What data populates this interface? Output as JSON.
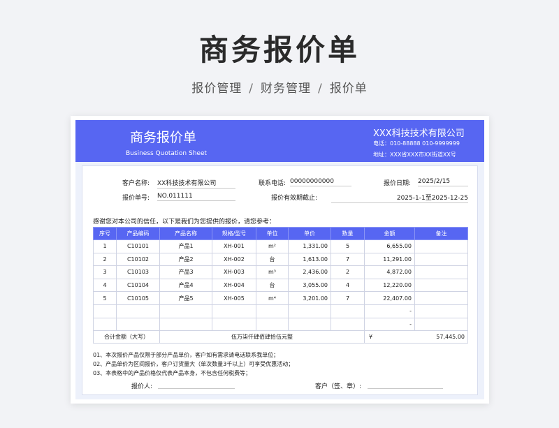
{
  "page": {
    "title": "商务报价单",
    "breadcrumb": [
      "报价管理",
      "财务管理",
      "报价单"
    ]
  },
  "header": {
    "doc_title": "商务报价单",
    "doc_subtitle": "Business Quotation Sheet",
    "company": "XXX科技技术有限公司",
    "contact": "电话：010-88888    010-9999999",
    "address": "地址：XXX省XXX市XX街道XX号"
  },
  "info": {
    "customer_label": "客户名称:",
    "customer_value": "XX科技技术有限公司",
    "phone_label": "联系电话:",
    "phone_value": "00000000000",
    "date_label": "报价日期:",
    "date_value": "2025/2/15",
    "number_label": "报价单号:",
    "number_value": "NO.011111",
    "valid_label": "报价有效期截止:",
    "valid_value": "2025-1-1至2025-12-25"
  },
  "intro": "感谢您对本公司的信任，以下是我们为您提供的报价，请您参考：",
  "table": {
    "headers": [
      "序号",
      "产品编码",
      "产品名称",
      "规格/型号",
      "单位",
      "单价",
      "数量",
      "金额",
      "备注"
    ],
    "rows": [
      {
        "no": "1",
        "code": "C10101",
        "name": "产品1",
        "spec": "XH-001",
        "unit": "m²",
        "price": "1,331.00",
        "qty": "5",
        "amount": "6,655.00",
        "remark": ""
      },
      {
        "no": "2",
        "code": "C10102",
        "name": "产品2",
        "spec": "XH-002",
        "unit": "台",
        "price": "1,613.00",
        "qty": "7",
        "amount": "11,291.00",
        "remark": ""
      },
      {
        "no": "3",
        "code": "C10103",
        "name": "产品3",
        "spec": "XH-003",
        "unit": "m³",
        "price": "2,436.00",
        "qty": "2",
        "amount": "4,872.00",
        "remark": ""
      },
      {
        "no": "4",
        "code": "C10104",
        "name": "产品4",
        "spec": "XH-004",
        "unit": "台",
        "price": "3,055.00",
        "qty": "4",
        "amount": "12,220.00",
        "remark": ""
      },
      {
        "no": "5",
        "code": "C10105",
        "name": "产品5",
        "spec": "XH-005",
        "unit": "m⁴",
        "price": "3,201.00",
        "qty": "7",
        "amount": "22,407.00",
        "remark": ""
      },
      {
        "no": "",
        "code": "",
        "name": "",
        "spec": "",
        "unit": "",
        "price": "",
        "qty": "",
        "amount": "-",
        "remark": ""
      },
      {
        "no": "",
        "code": "",
        "name": "",
        "spec": "",
        "unit": "",
        "price": "",
        "qty": "",
        "amount": "-",
        "remark": ""
      }
    ],
    "total_label": "合计金额（大写）",
    "total_words": "伍万柒仟肆佰肆拾伍元整",
    "currency": "¥",
    "total_value": "57,445.00"
  },
  "notes": [
    "01、本次报价产品仅限于部分产品单价，客户如有需求请电话联系我单位；",
    "02、产品单价为区间报价，客户订货量大（单次数量3千以上）可享受优惠活动；",
    "03、本表格中的产品价格仅代表产品本身，不包含任何税费等；"
  ],
  "signature": {
    "quoter_label": "报价人:",
    "customer_label": "客户（签、章）:"
  }
}
